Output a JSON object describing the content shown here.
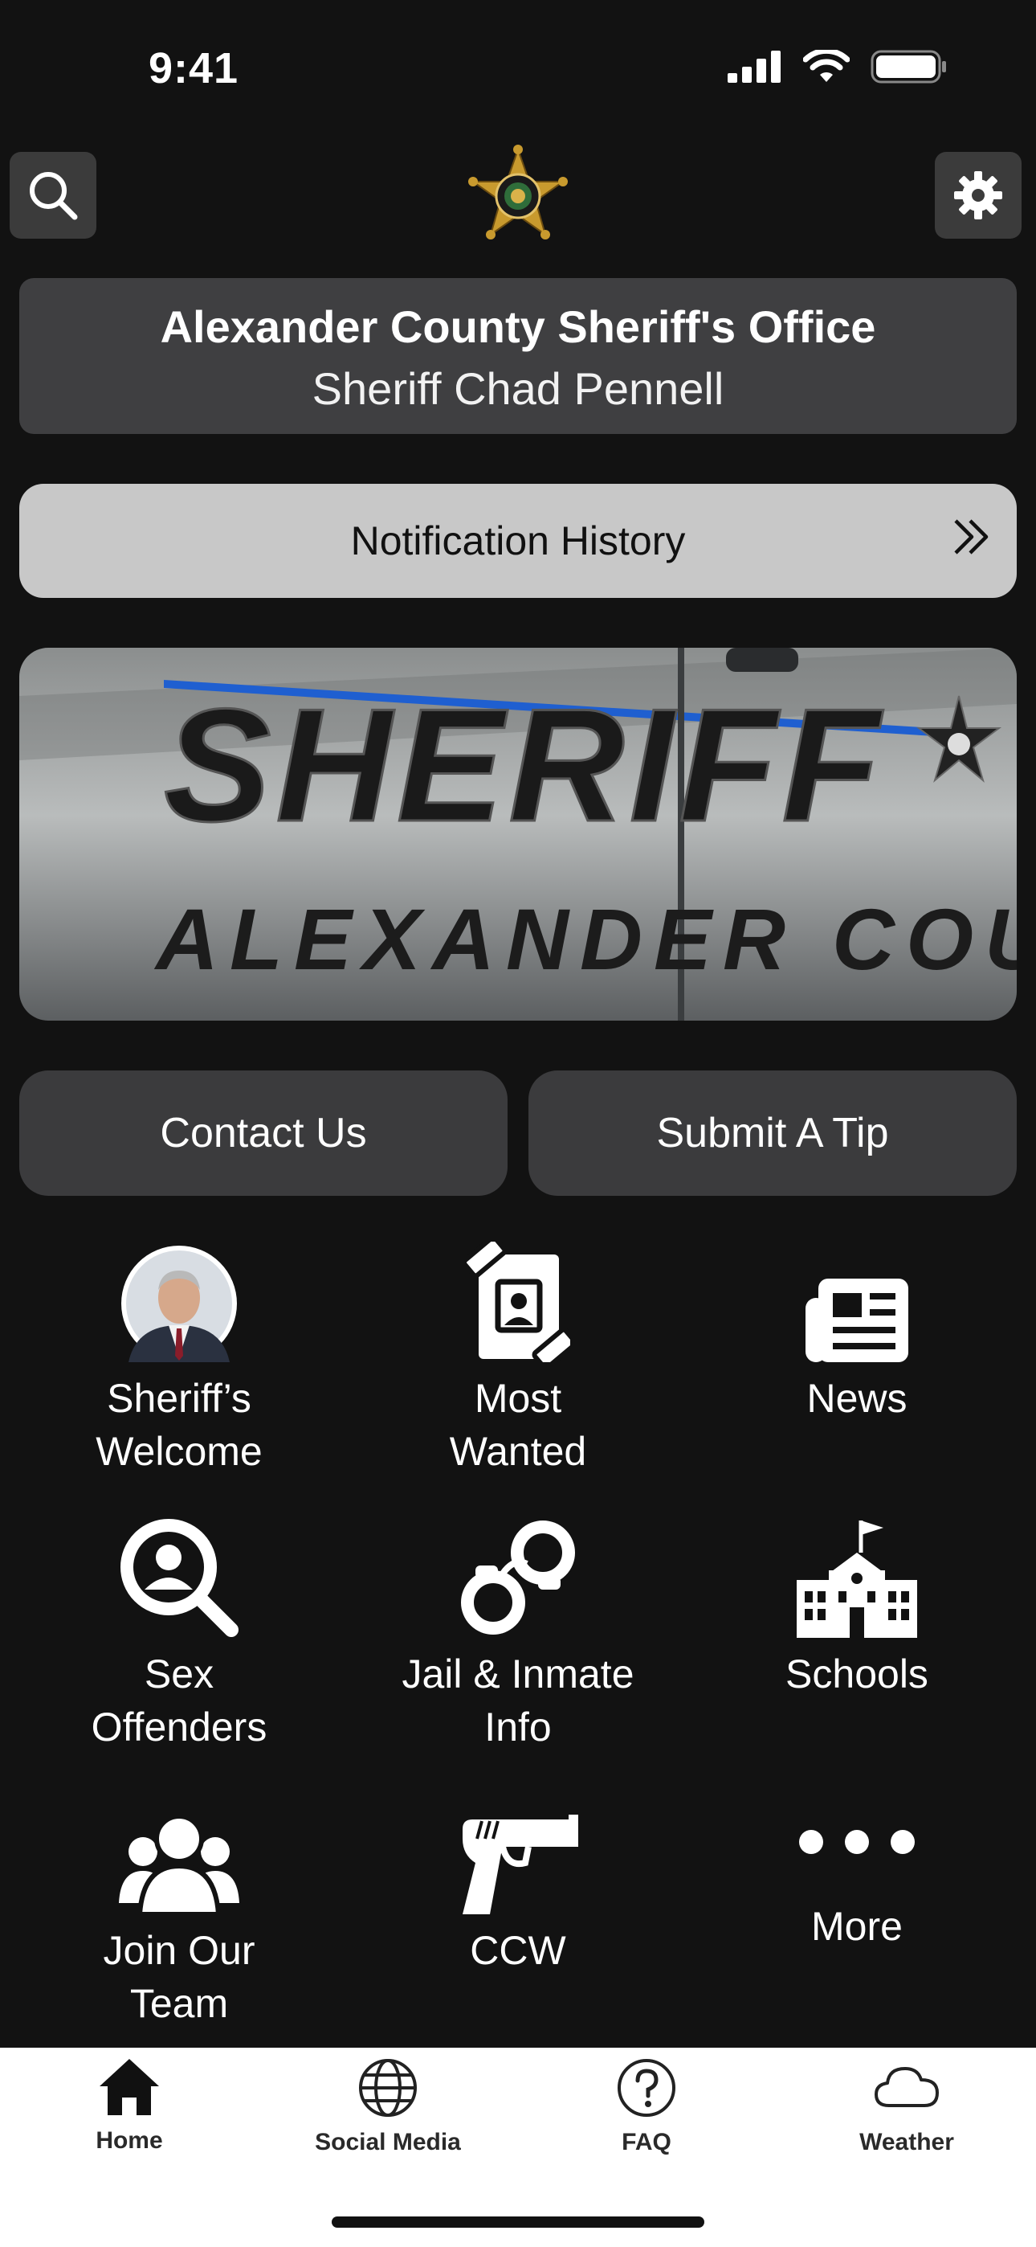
{
  "status": {
    "time": "9:41"
  },
  "header": {
    "agency": "Alexander County Sheriff's Office",
    "sheriff": "Sheriff Chad Pennell"
  },
  "notification": {
    "label": "Notification History"
  },
  "hero": {
    "line1": "SHERIFF",
    "line2": "ALEXANDER COUNTY"
  },
  "actions": {
    "contact": "Contact Us",
    "tip": "Submit A Tip"
  },
  "grid": [
    {
      "label": "Sheriff’s\nWelcome",
      "icon": "sheriff-portrait-icon"
    },
    {
      "label": "Most\nWanted",
      "icon": "most-wanted-icon"
    },
    {
      "label": "News",
      "icon": "newspaper-icon"
    },
    {
      "label": "Sex\nOffenders",
      "icon": "search-person-icon"
    },
    {
      "label": "Jail & Inmate\nInfo",
      "icon": "handcuffs-icon"
    },
    {
      "label": "Schools",
      "icon": "school-icon"
    },
    {
      "label": "Join Our\nTeam",
      "icon": "group-icon"
    },
    {
      "label": "CCW",
      "icon": "pistol-icon"
    },
    {
      "label": "More",
      "icon": "more-icon"
    }
  ],
  "tabs": [
    {
      "label": "Home",
      "icon": "home-icon"
    },
    {
      "label": "Social Media",
      "icon": "globe-icon"
    },
    {
      "label": "FAQ",
      "icon": "question-icon"
    },
    {
      "label": "Weather",
      "icon": "cloud-icon"
    }
  ],
  "colors": {
    "background": "#121212",
    "card": "#3f3f41",
    "notification": "#c8c8c8",
    "badge_gold": "#c89a2e"
  }
}
